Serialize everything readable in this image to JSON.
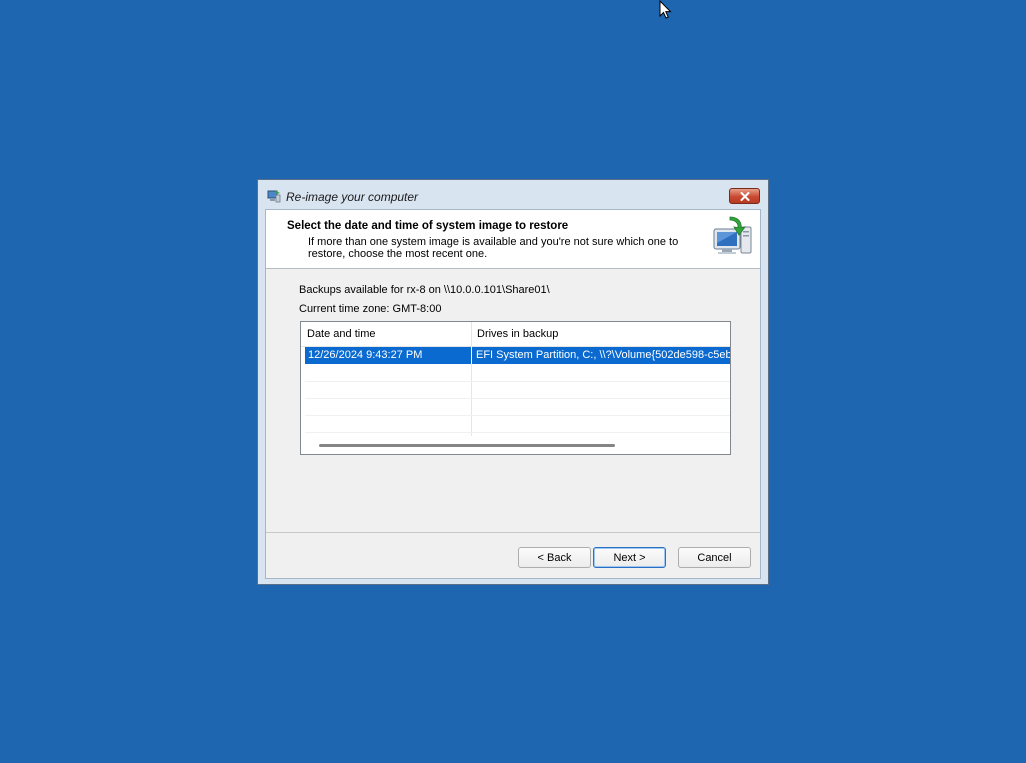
{
  "window": {
    "title": "Re-image your computer",
    "close_glyph": "✕"
  },
  "header": {
    "title": "Select the date and time of system image to restore",
    "description": "If more than one system image is available and you're not sure which one to restore, choose the most recent one.",
    "icon": "computer-restore-icon"
  },
  "info": {
    "backups_available": "Backups available for rx-8 on \\\\10.0.0.101\\Share01\\",
    "time_zone": "Current time zone: GMT-8:00"
  },
  "backup_list": {
    "columns": [
      "Date and time",
      "Drives in backup"
    ],
    "rows": [
      {
        "date_time": "12/26/2024 9:43:27 PM",
        "drives": "EFI System Partition, C:, \\\\?\\Volume{502de598-c5eb",
        "selected": true
      }
    ]
  },
  "buttons": {
    "back": "< Back",
    "next": "Next >",
    "cancel": "Cancel"
  },
  "colors": {
    "desktop": "#1f66b1",
    "selection": "#0a6ad0",
    "close_button": "#c94a32"
  }
}
